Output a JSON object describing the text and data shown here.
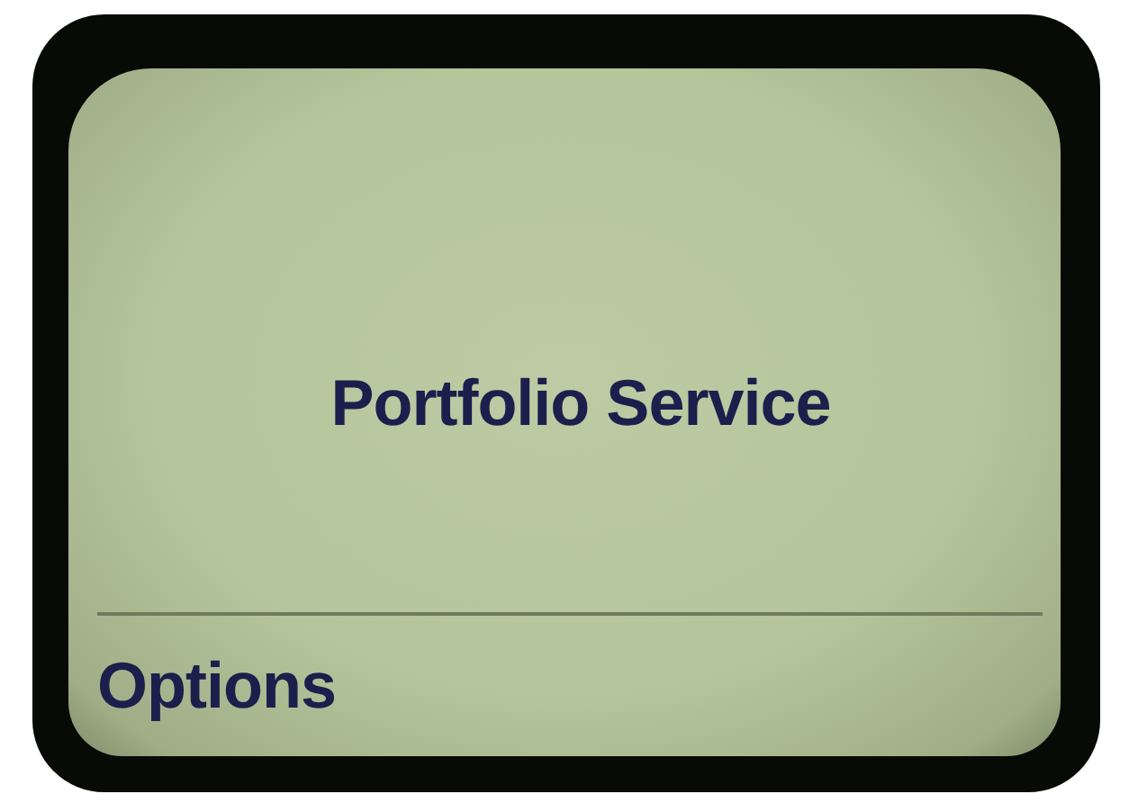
{
  "screen": {
    "title": "Portfolio Service"
  },
  "softkey": {
    "label": "Options"
  }
}
